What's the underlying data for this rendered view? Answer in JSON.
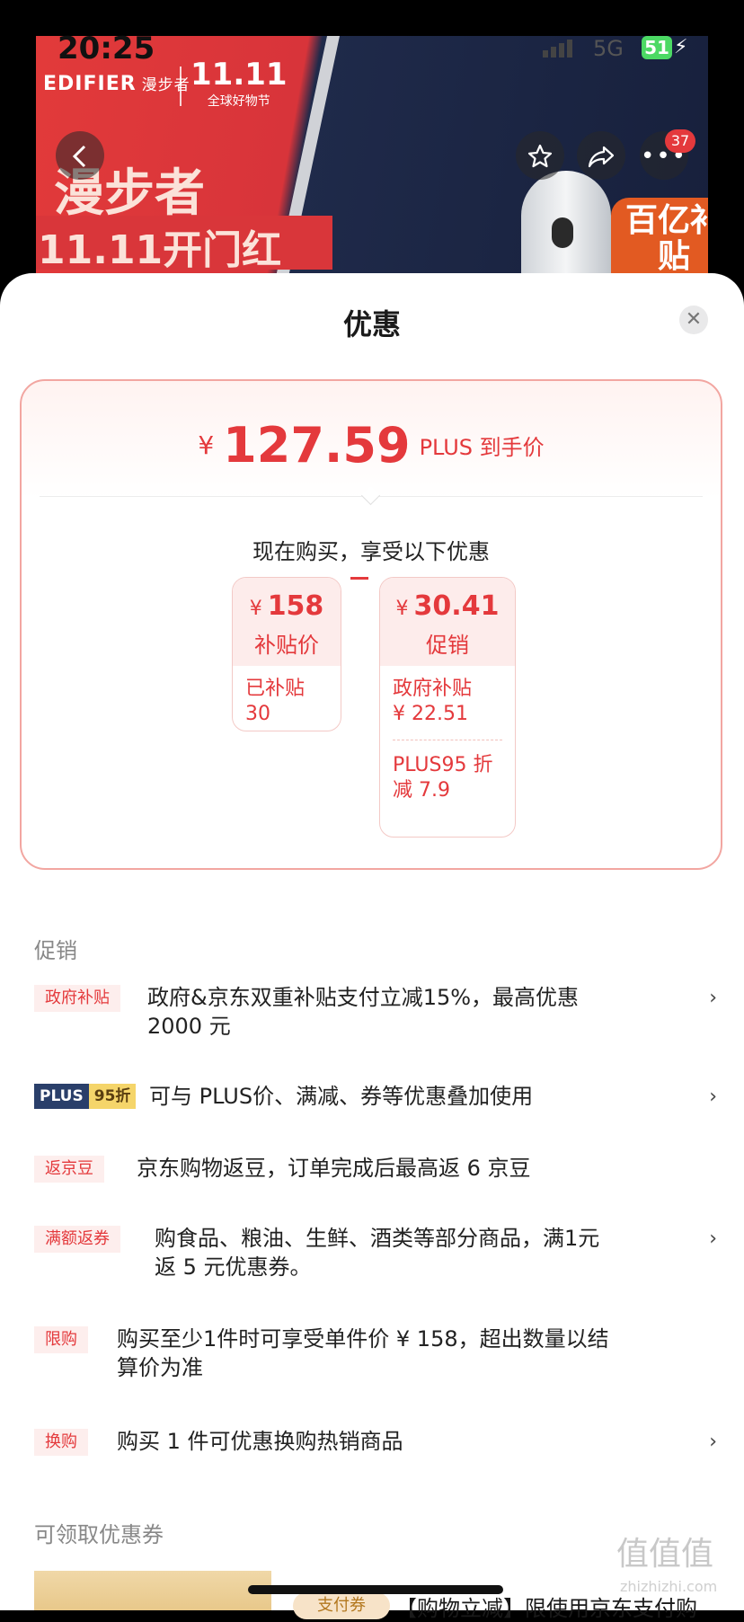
{
  "status": {
    "time": "20:25",
    "network": "5G",
    "battery": "51"
  },
  "banner": {
    "brand": "EDIFIER",
    "brand_cn": "漫步者",
    "festival_big": "11.11",
    "festival_sub": "全球好物节",
    "slogan_line1": "漫步者",
    "slogan_line2": "11.11开门红",
    "badge": "百亿补贴",
    "share_count": "37"
  },
  "sheet": {
    "title": "优惠",
    "price": {
      "currency": "¥",
      "value": "127.59",
      "label": "PLUS 到手价"
    },
    "enjoy_text": "现在购买，享受以下优惠",
    "box_left": {
      "currency": "¥",
      "value": "158",
      "title": "补贴价",
      "line1": "已补贴",
      "line2": "30"
    },
    "box_right": {
      "currency": "¥",
      "value": "30.41",
      "title": "促销",
      "item1_line1": "政府补贴",
      "item1_line2": "¥ 22.51",
      "item2_line1": "PLUS95 折",
      "item2_line2": "减 7.9"
    },
    "promo_section": "促销",
    "promos": [
      {
        "tag": "政府补贴",
        "text_line1": "政府&京东双重补贴支付立减15%，最高优惠",
        "text_line2": "2000 元"
      },
      {
        "tag_a": "PLUS",
        "tag_b": "95折",
        "text_line1": "可与 PLUS价、满减、券等优惠叠加使用"
      },
      {
        "tag": "返京豆",
        "text_line1": "京东购物返豆，订单完成后最高返 6 京豆"
      },
      {
        "tag": "满额返券",
        "text_line1": "购食品、粮油、生鲜、酒类等部分商品，满1元",
        "text_line2": "返 5 元优惠券。"
      },
      {
        "tag": "限购",
        "text_line1": "购买至少1件时可享受单件价 ¥ 158，超出数量以结",
        "text_line2": "算价为准"
      },
      {
        "tag": "换购",
        "text_line1": "购买 1 件可优惠换购热销商品"
      }
    ],
    "coupon_section": "可领取优惠券",
    "coupon_tag": "支付券",
    "coupon_text": "【购物立减】限使用京东支付购",
    "watermark": "值值值",
    "watermark_sub": "zhizhizhi.com"
  }
}
